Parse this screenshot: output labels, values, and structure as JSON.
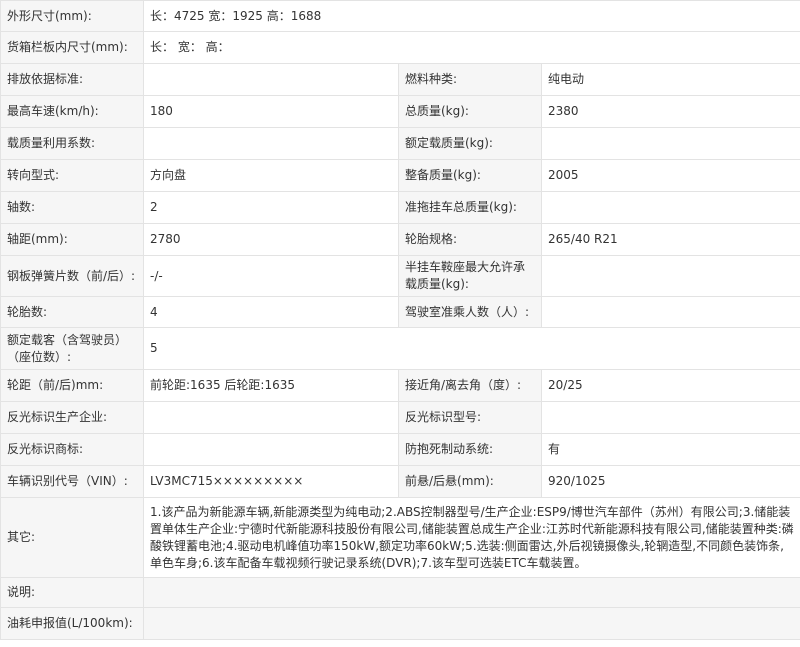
{
  "rows": {
    "r1": {
      "label": "外形尺寸(mm):",
      "value": "长：4725 宽：1925 高：1688"
    },
    "r2": {
      "label": "货箱栏板内尺寸(mm):",
      "value": "长：  宽：  高："
    },
    "r3": {
      "l1": "排放依据标准:",
      "v1": "",
      "l2": "燃料种类:",
      "v2": "纯电动"
    },
    "r4": {
      "l1": "最高车速(km/h):",
      "v1": "180",
      "l2": "总质量(kg):",
      "v2": "2380"
    },
    "r5": {
      "l1": "载质量利用系数:",
      "v1": "",
      "l2": "额定载质量(kg):",
      "v2": ""
    },
    "r6": {
      "l1": "转向型式:",
      "v1": "方向盘",
      "l2": "整备质量(kg):",
      "v2": "2005"
    },
    "r7": {
      "l1": "轴数:",
      "v1": "2",
      "l2": "准拖挂车总质量(kg):",
      "v2": ""
    },
    "r8": {
      "l1": "轴距(mm):",
      "v1": "2780",
      "l2": "轮胎规格:",
      "v2": "265/40 R21"
    },
    "r9": {
      "l1": "钢板弹簧片数（前/后）:",
      "v1": "-/-",
      "l2": "半挂车鞍座最大允许承载质量(kg):",
      "v2": ""
    },
    "r10": {
      "l1": "轮胎数:",
      "v1": "4",
      "l2": "驾驶室准乘人数（人）:",
      "v2": ""
    },
    "r11": {
      "label": "额定载客（含驾驶员）（座位数）:",
      "value": "5"
    },
    "r12": {
      "l1": "轮距（前/后)mm:",
      "v1": "前轮距:1635 后轮距:1635",
      "l2": "接近角/离去角（度）:",
      "v2": "20/25"
    },
    "r13": {
      "l1": "反光标识生产企业:",
      "v1": "",
      "l2": "反光标识型号:",
      "v2": ""
    },
    "r14": {
      "l1": "反光标识商标:",
      "v1": "",
      "l2": "防抱死制动系统:",
      "v2": "有"
    },
    "r15": {
      "l1": "车辆识别代号（VIN）:",
      "v1": "LV3MC715×××××××××",
      "l2": "前悬/后悬(mm):",
      "v2": "920/1025"
    },
    "r16": {
      "label": "其它:",
      "value": "1.该产品为新能源车辆,新能源类型为纯电动;2.ABS控制器型号/生产企业:ESP9/博世汽车部件（苏州）有限公司;3.储能装置单体生产企业:宁德时代新能源科技股份有限公司,储能装置总成生产企业:江苏时代新能源科技有限公司,储能装置种类:磷酸铁锂蓄电池;4.驱动电机峰值功率150kW,额定功率60kW;5.选装:侧面雷达,外后视镜摄像头,轮辋造型,不同颜色装饰条,单色车身;6.该车配备车载视频行驶记录系统(DVR);7.该车型可选装ETC车载装置。"
    },
    "r17": {
      "label": "说明:",
      "value": ""
    },
    "r18": {
      "label": "油耗申报值(L/100km):",
      "value": ""
    }
  }
}
